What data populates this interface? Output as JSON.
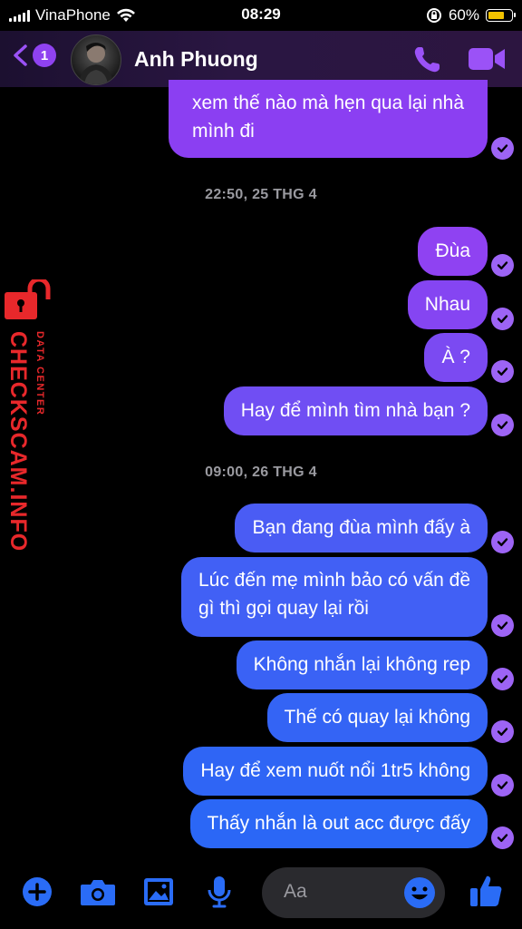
{
  "status_bar": {
    "carrier": "VinaPhone",
    "time": "08:29",
    "battery": "60%"
  },
  "header": {
    "back_badge": "1",
    "contact_name": "Anh Phuong"
  },
  "watermark": {
    "brand": "CHECKSCAM.INFO",
    "sub": "DATA CENTER"
  },
  "messages": [
    {
      "text_line1": "xem thế nào mà hẹn qua lại nhà",
      "text_line2": "mình đi"
    },
    {
      "timestamp": "22:50, 25 THG 4"
    },
    {
      "text": "Đùa"
    },
    {
      "text": "Nhau"
    },
    {
      "text": "À ?"
    },
    {
      "text": "Hay để mình tìm nhà bạn ?"
    },
    {
      "timestamp": "09:00, 26 THG 4"
    },
    {
      "text": "Bạn đang đùa mình đấy à"
    },
    {
      "text_line1": "Lúc đến mẹ mình bảo có vấn đề",
      "text_line2": "gì thì gọi quay lại rồi"
    },
    {
      "text": "Không nhắn lại không rep"
    },
    {
      "text": "Thế có quay lại không"
    },
    {
      "text": "Hay để xem nuốt nổi 1tr5 không"
    },
    {
      "text": "Thấy nhắn là out acc được đấy"
    }
  ],
  "composer": {
    "placeholder": "Aa"
  },
  "colors": {
    "purple_bubble": "#8b3ff2",
    "blue_bubble": "#2f63f5",
    "accent": "#9b52f7"
  }
}
